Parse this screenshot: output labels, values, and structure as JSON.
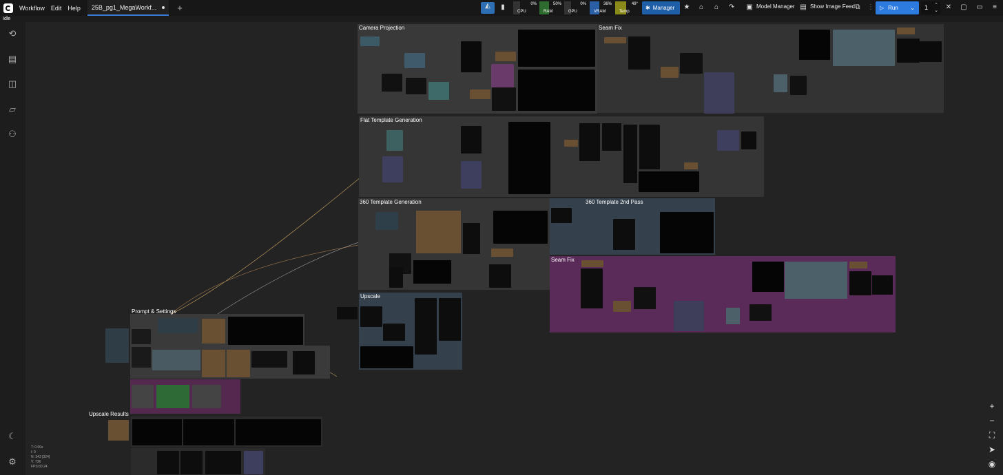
{
  "menu": {
    "workflow": "Workflow",
    "edit": "Edit",
    "help": "Help"
  },
  "tab": {
    "label": "25B_pg1_MegaWorkf..."
  },
  "status": {
    "text": "Idle"
  },
  "monitors": [
    {
      "label": "CPU",
      "value": "0%",
      "color": "#333333"
    },
    {
      "label": "RAM",
      "value": "50%",
      "color": "#2e6b2e"
    },
    {
      "label": "GPU",
      "value": "0%",
      "color": "#333333"
    },
    {
      "label": "VRAM",
      "value": "36%",
      "color": "#2a5fa5"
    },
    {
      "label": "Temp",
      "value": "49°",
      "color": "#8a8a1a"
    }
  ],
  "toolbar": {
    "manager": "Manager",
    "model_manager": "Model Manager",
    "image_feed": "Show Image Feed",
    "run": "Run",
    "batch_count": "1"
  },
  "groups": {
    "camera_projection": "Camera Projection",
    "seam_fix_top": "Seam Fix",
    "flat_template": "Flat Template Generation",
    "template_360": "360 Template Generation",
    "template_360_second": "360 Template 2nd Pass",
    "seam_fix_mid": "Seam Fix",
    "upscale": "Upscale",
    "prompt_settings": "Prompt & Settings",
    "upscale_results": "Upscale Results"
  },
  "stats": {
    "t": "T: 0.00s",
    "i": "I: 0",
    "n": "N: 343 [324]",
    "v": "V: 736",
    "fps": "FPS:60.24"
  },
  "colors": {
    "accent": "#2e7be0",
    "group_gray": "#3a3a3a",
    "group_blue": "#34414d",
    "group_purple": "#5a2a58"
  }
}
